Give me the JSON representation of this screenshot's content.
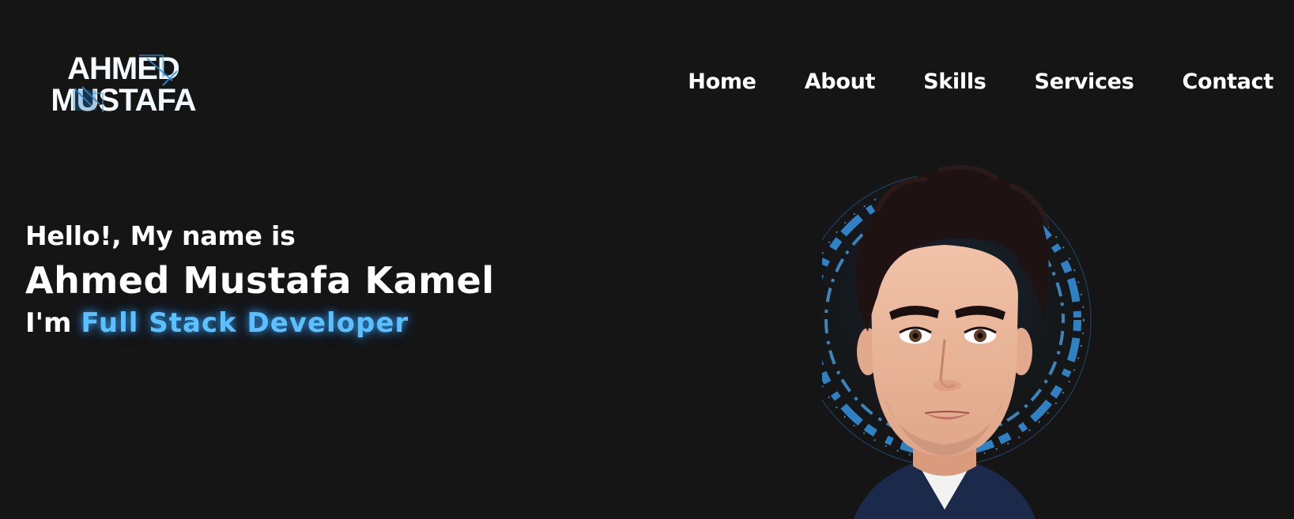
{
  "brand": {
    "line1": "AHMED",
    "line2": "MUSTAFA"
  },
  "nav": {
    "items": [
      {
        "label": "Home"
      },
      {
        "label": "About"
      },
      {
        "label": "Skills"
      },
      {
        "label": "Services"
      },
      {
        "label": "Contact"
      }
    ]
  },
  "hero": {
    "greeting": "Hello!, My name is",
    "name": "Ahmed Mustafa Kamel",
    "role_prefix": "I'm",
    "role": "Full Stack Developer"
  },
  "colors": {
    "background": "#151515",
    "accent": "#5cc0ff",
    "text": "#ffffff"
  },
  "icons": {
    "avatar": "developer-avatar-illustration"
  }
}
